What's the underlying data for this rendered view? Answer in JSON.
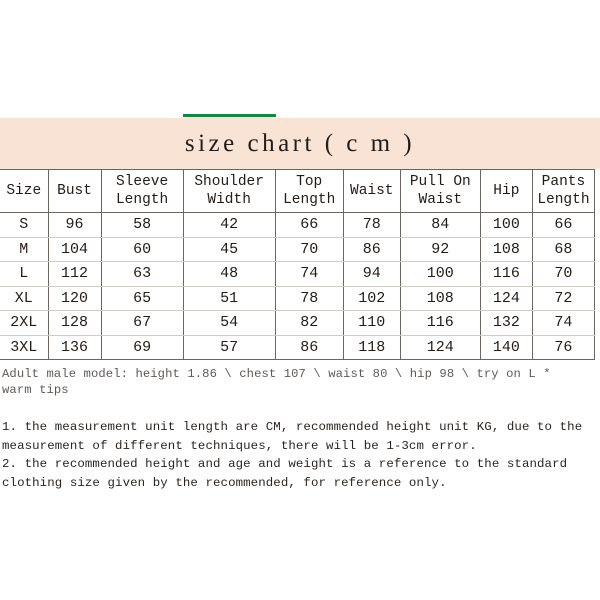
{
  "title_band": {
    "title": "size chart ( c m )",
    "background": "#f9e3d4",
    "accent_rule_color": "#0e8a3c"
  },
  "table": {
    "headers": [
      "Size",
      "Bust",
      "Sleeve Length",
      "Shoulder Width",
      "Top Length",
      "Waist",
      "Pull On Waist",
      "Hip",
      "Pants Length"
    ],
    "header_lines": [
      [
        "Size"
      ],
      [
        "Bust"
      ],
      [
        "Sleeve",
        "Length"
      ],
      [
        "Shoulder",
        "Width"
      ],
      [
        "Top",
        "Length"
      ],
      [
        "Waist"
      ],
      [
        "Pull On",
        "Waist"
      ],
      [
        "Hip"
      ],
      [
        "Pants",
        "Length"
      ]
    ],
    "rows": [
      {
        "size": "S",
        "bust": "96",
        "sleeve_length": "58",
        "shoulder_width": "42",
        "top_length": "66",
        "waist": "78",
        "pull_on_waist": "84",
        "hip": "100",
        "pants_length": "66"
      },
      {
        "size": "M",
        "bust": "104",
        "sleeve_length": "60",
        "shoulder_width": "45",
        "top_length": "70",
        "waist": "86",
        "pull_on_waist": "92",
        "hip": "108",
        "pants_length": "68"
      },
      {
        "size": "L",
        "bust": "112",
        "sleeve_length": "63",
        "shoulder_width": "48",
        "top_length": "74",
        "waist": "94",
        "pull_on_waist": "100",
        "hip": "116",
        "pants_length": "70"
      },
      {
        "size": "XL",
        "bust": "120",
        "sleeve_length": "65",
        "shoulder_width": "51",
        "top_length": "78",
        "waist": "102",
        "pull_on_waist": "108",
        "hip": "124",
        "pants_length": "72"
      },
      {
        "size": "2XL",
        "bust": "128",
        "sleeve_length": "67",
        "shoulder_width": "54",
        "top_length": "82",
        "waist": "110",
        "pull_on_waist": "116",
        "hip": "132",
        "pants_length": "74"
      },
      {
        "size": "3XL",
        "bust": "136",
        "sleeve_length": "69",
        "shoulder_width": "57",
        "top_length": "86",
        "waist": "118",
        "pull_on_waist": "124",
        "hip": "140",
        "pants_length": "76"
      }
    ]
  },
  "model_note": {
    "line1": "Adult male model: height 1.86 \\ chest 107 \\ waist 80 \\ hip 98 \\ try on L *",
    "line2": "warm tips"
  },
  "notes": {
    "note1_line1": "1. the measurement unit length are CM, recommended height unit KG, due to the",
    "note1_line2": "measurement of different techniques, there will be 1-3cm error.",
    "note2_line1": "2. the recommended height and age and weight is a reference to the standard",
    "note2_line2": "clothing size given by the recommended, for reference only."
  }
}
